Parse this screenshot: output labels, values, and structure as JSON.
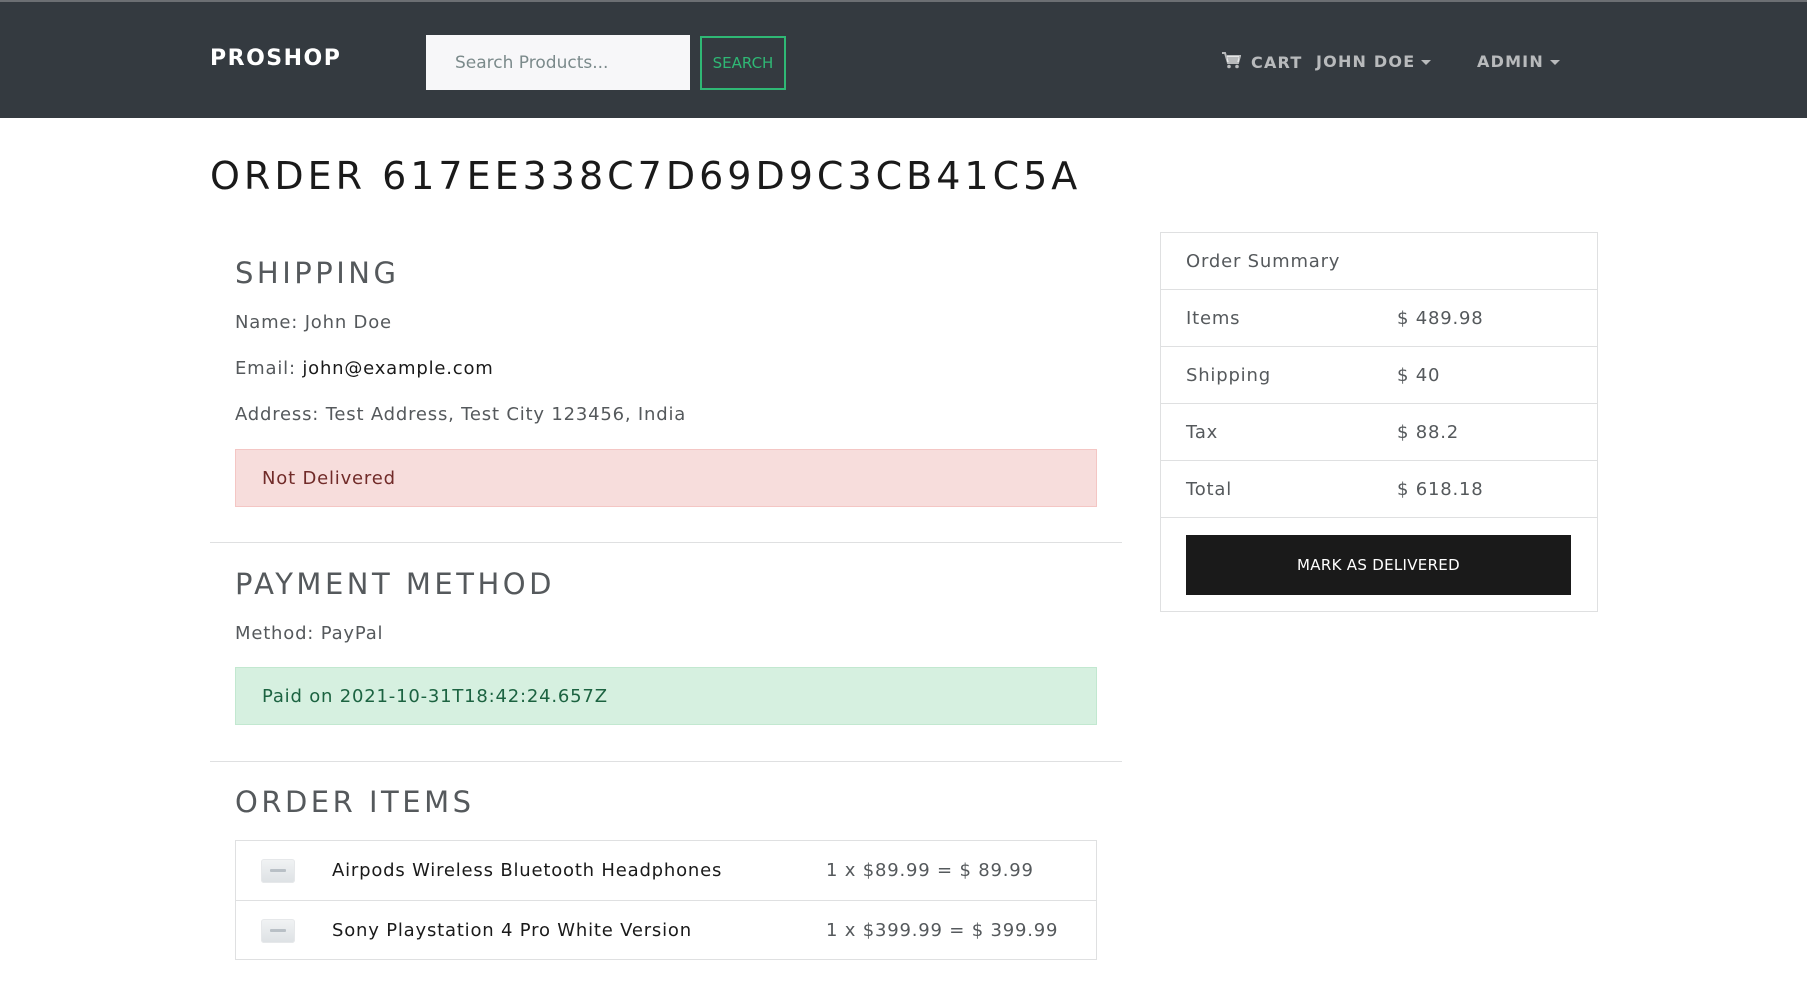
{
  "navbar": {
    "brand": "PROSHOP",
    "search_placeholder": "Search Products...",
    "search_button": "SEARCH",
    "cart_label": "CART",
    "user_label": "JOHN DOE",
    "admin_label": "ADMIN"
  },
  "order": {
    "title": "ORDER 617EE338C7D69D9C3CB41C5A"
  },
  "shipping": {
    "heading": "SHIPPING",
    "name_label": "Name:",
    "name_value": "John Doe",
    "email_label": "Email:",
    "email_value": "john@example.com",
    "address_label": "Address:",
    "address_value": "Test Address, Test City 123456, India",
    "status": "Not Delivered"
  },
  "payment": {
    "heading": "PAYMENT METHOD",
    "method_label": "Method:",
    "method_value": "PayPal",
    "status": "Paid on 2021-10-31T18:42:24.657Z"
  },
  "order_items": {
    "heading": "ORDER ITEMS",
    "items": [
      {
        "name": "Airpods Wireless Bluetooth Headphones",
        "price": "1 x $89.99 = $ 89.99"
      },
      {
        "name": "Sony Playstation 4 Pro White Version",
        "price": "1 x $399.99 = $ 399.99"
      }
    ]
  },
  "summary": {
    "heading": "Order Summary",
    "rows": [
      {
        "label": "Items",
        "value": "$ 489.98"
      },
      {
        "label": "Shipping",
        "value": "$ 40"
      },
      {
        "label": "Tax",
        "value": "$ 88.2"
      },
      {
        "label": "Total",
        "value": "$ 618.18"
      }
    ],
    "mark_delivered_button": "MARK AS DELIVERED"
  },
  "colors": {
    "navbar_bg": "#343a40",
    "search_accent": "#2fb875",
    "danger_bg": "#f7dddc",
    "success_bg": "#d6f0e0",
    "button_dark": "#1a1a1a"
  },
  "icons": {
    "cart": "cart-icon",
    "user_dropdown": "chevron-down-icon",
    "admin_dropdown": "chevron-down-icon"
  }
}
